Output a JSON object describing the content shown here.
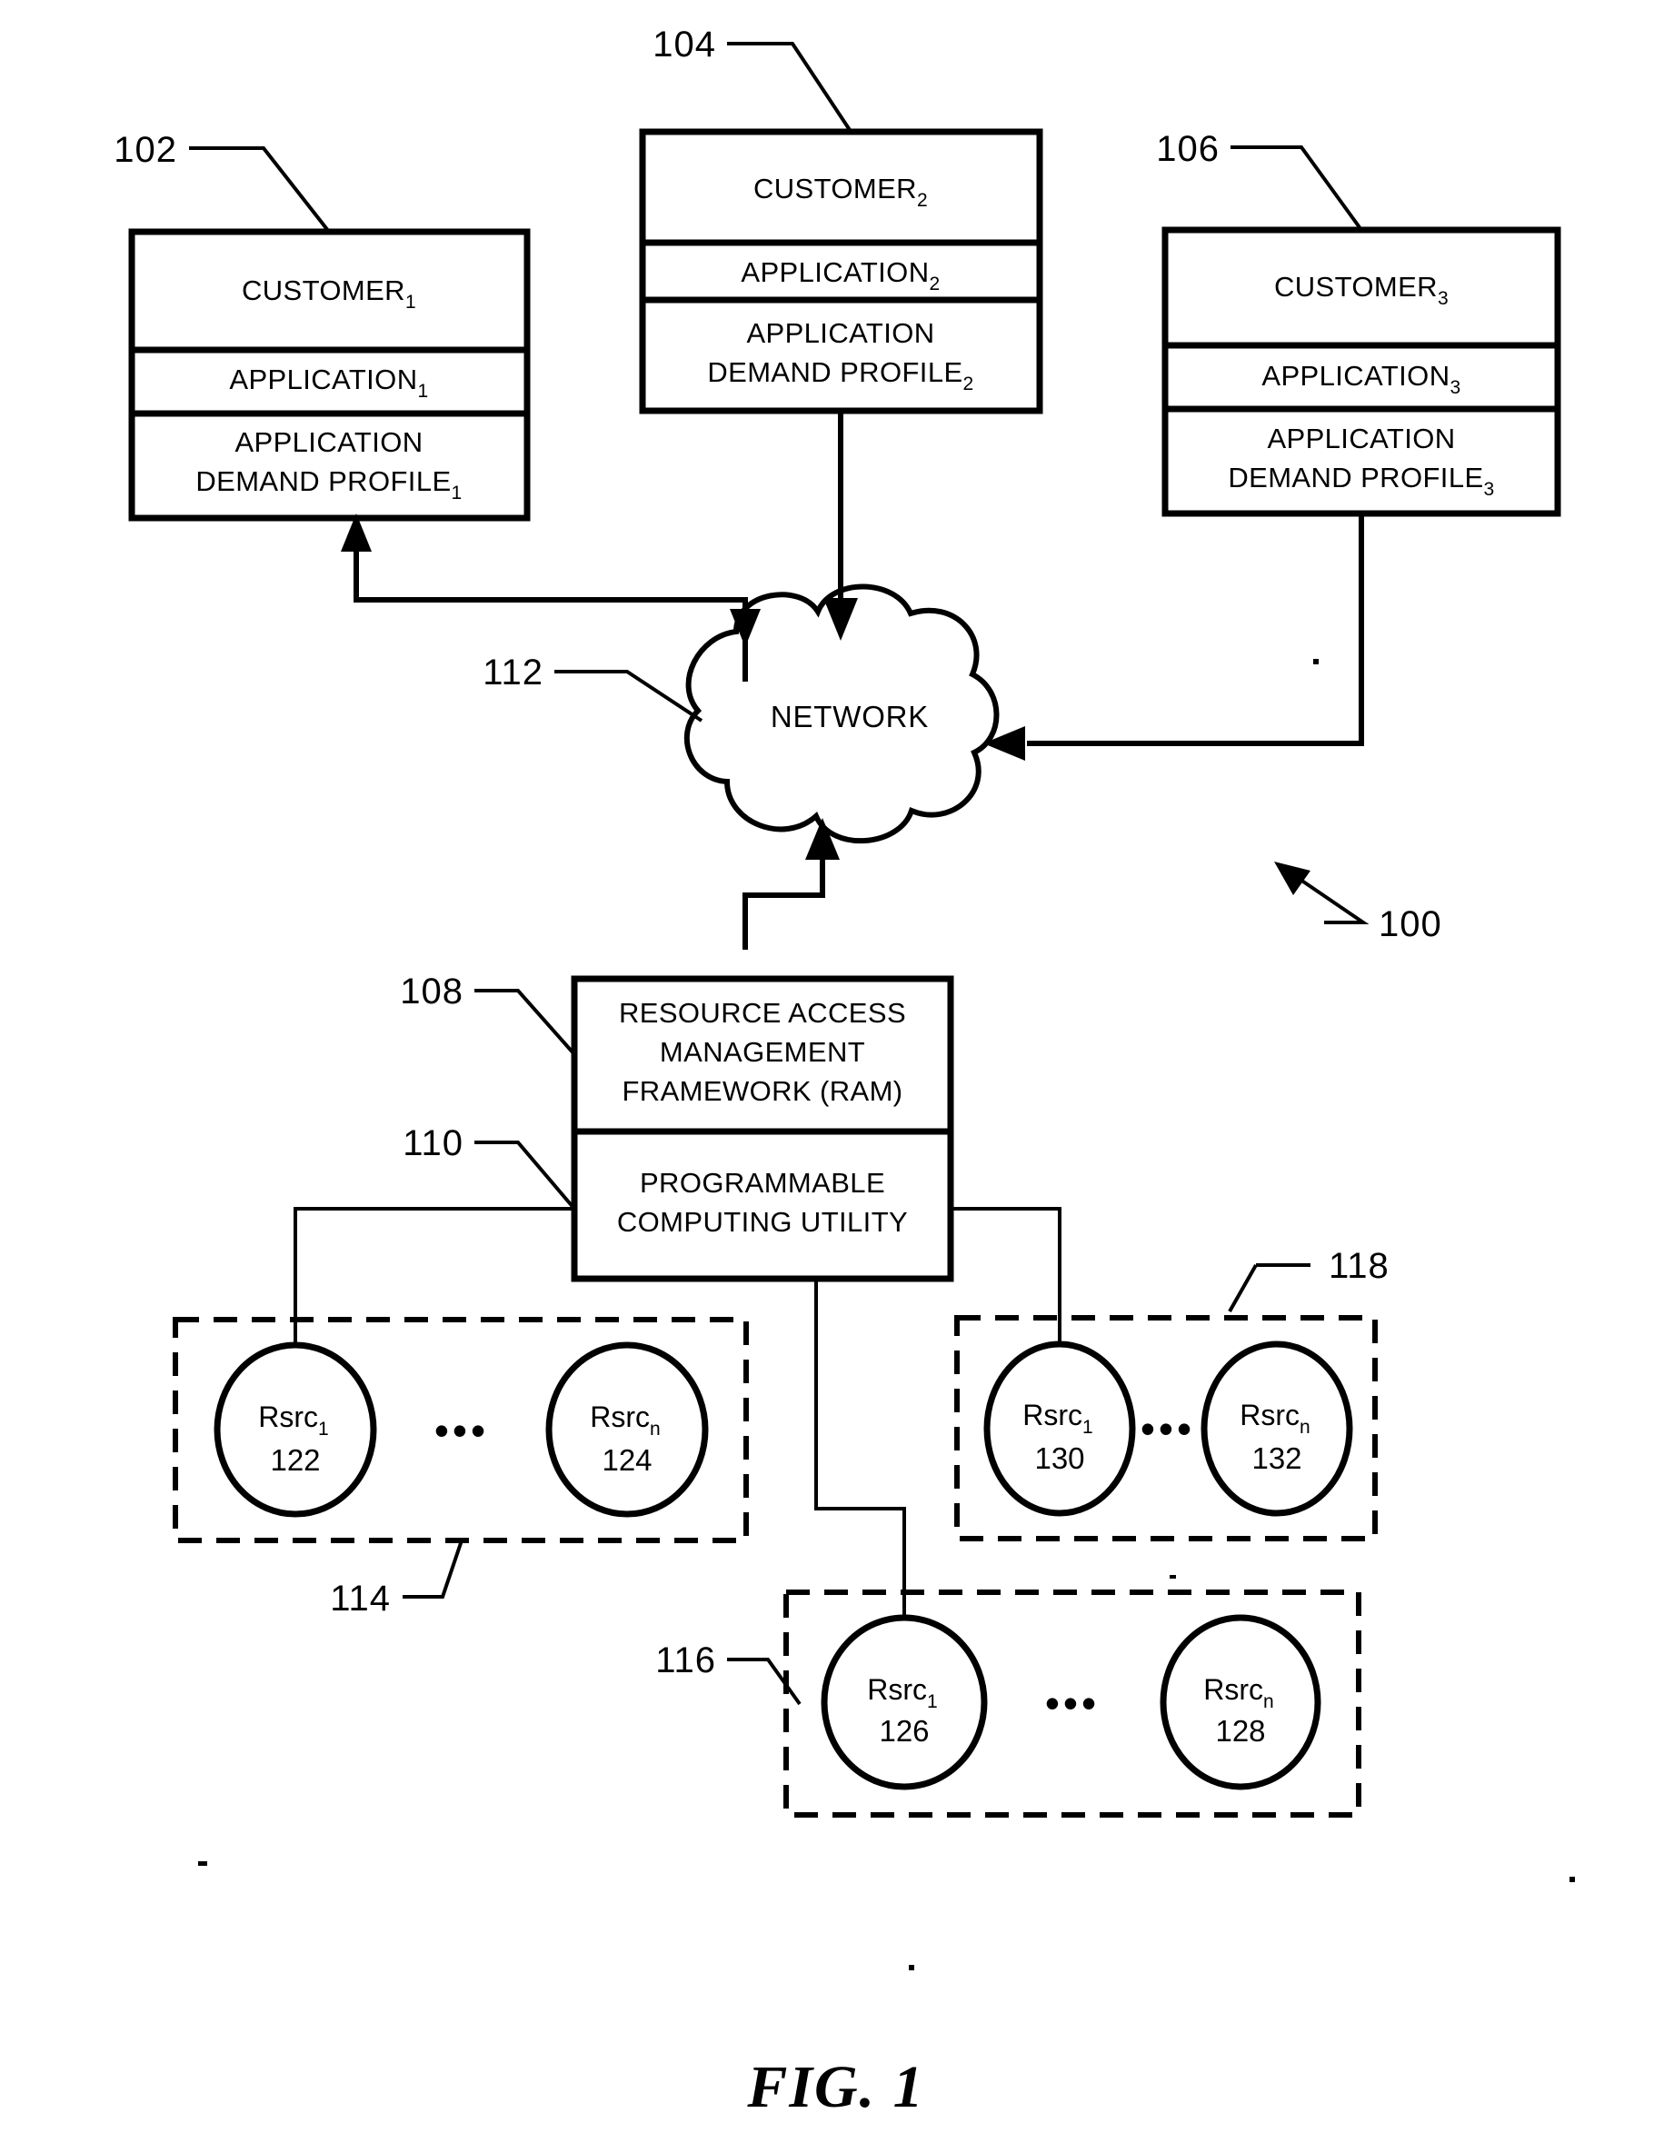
{
  "figure": {
    "caption": "FIG. 1",
    "system_ref": "100"
  },
  "customers": [
    {
      "ref": "102",
      "title": "CUSTOMER",
      "title_sub": "1",
      "application": "APPLICATION",
      "application_sub": "1",
      "profile_line1": "APPLICATION",
      "profile_line2": "DEMAND PROFILE",
      "profile_sub": "1"
    },
    {
      "ref": "104",
      "title": "CUSTOMER",
      "title_sub": "2",
      "application": "APPLICATION",
      "application_sub": "2",
      "profile_line1": "APPLICATION",
      "profile_line2": "DEMAND PROFILE",
      "profile_sub": "2"
    },
    {
      "ref": "106",
      "title": "CUSTOMER",
      "title_sub": "3",
      "application": "APPLICATION",
      "application_sub": "3",
      "profile_line1": "APPLICATION",
      "profile_line2": "DEMAND PROFILE",
      "profile_sub": "3"
    }
  ],
  "network": {
    "ref": "112",
    "label": "NETWORK"
  },
  "framework": {
    "ref": "108",
    "line1": "RESOURCE ACCESS",
    "line2": "MANAGEMENT",
    "line3": "FRAMEWORK (RAM)"
  },
  "utility": {
    "ref": "110",
    "line1": "PROGRAMMABLE",
    "line2": "COMPUTING UTILITY"
  },
  "resource_groups": [
    {
      "ref": "114",
      "first": {
        "label": "Rsrc",
        "sub": "1",
        "num": "122"
      },
      "last": {
        "label": "Rsrc",
        "sub": "n",
        "num": "124"
      },
      "ellipsis": "•••"
    },
    {
      "ref": "116",
      "first": {
        "label": "Rsrc",
        "sub": "1",
        "num": "126"
      },
      "last": {
        "label": "Rsrc",
        "sub": "n",
        "num": "128"
      },
      "ellipsis": "•••"
    },
    {
      "ref": "118",
      "first": {
        "label": "Rsrc",
        "sub": "1",
        "num": "130"
      },
      "last": {
        "label": "Rsrc",
        "sub": "n",
        "num": "132"
      },
      "ellipsis": "•••"
    }
  ],
  "colors": {
    "ink": "#000000",
    "paper": "#ffffff"
  }
}
